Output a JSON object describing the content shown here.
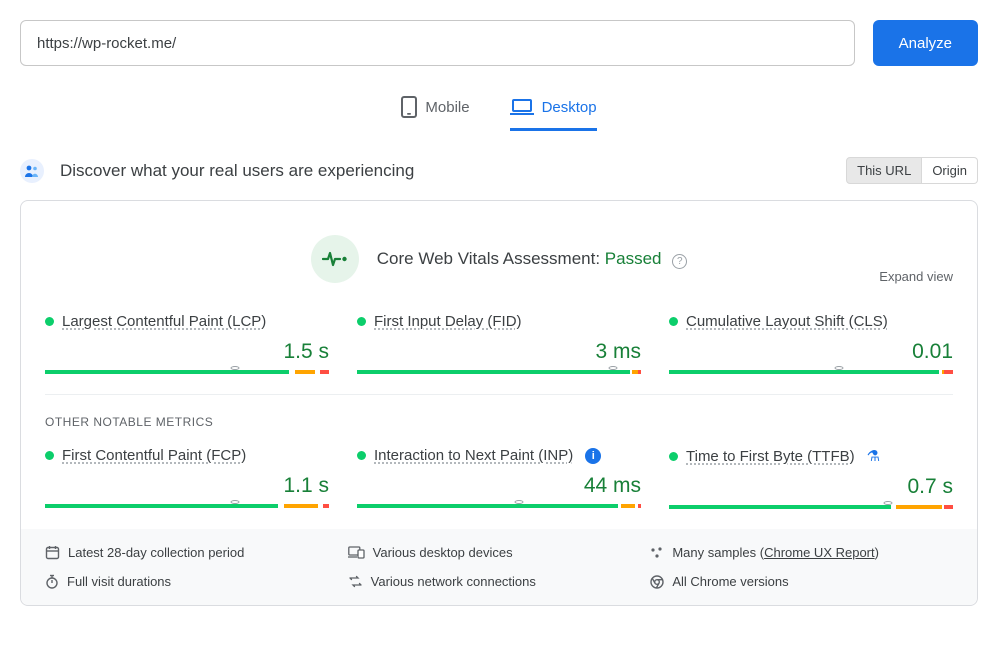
{
  "input": {
    "url_value": "https://wp-rocket.me/",
    "analyze_label": "Analyze"
  },
  "tabs": {
    "mobile": "Mobile",
    "desktop": "Desktop"
  },
  "discover": {
    "heading": "Discover what your real users are experiencing",
    "this_url": "This URL",
    "origin": "Origin"
  },
  "assessment": {
    "label_prefix": "Core Web Vitals Assessment: ",
    "status": "Passed",
    "expand": "Expand view"
  },
  "section": {
    "other": "OTHER NOTABLE METRICS"
  },
  "metrics": {
    "lcp": {
      "name": "Largest Contentful Paint (LCP)",
      "value": "1.5 s",
      "marker": 67,
      "segs": [
        86,
        2,
        7,
        2,
        3
      ]
    },
    "fid": {
      "name": "First Input Delay (FID)",
      "value": "3 ms",
      "marker": 90,
      "segs": [
        96,
        1,
        2,
        0,
        1
      ]
    },
    "cls": {
      "name": "Cumulative Layout Shift (CLS)",
      "value": "0.01",
      "marker": 60,
      "segs": [
        95,
        1,
        1,
        0,
        3
      ]
    },
    "fcp": {
      "name": "First Contentful Paint (FCP)",
      "value": "1.1 s",
      "marker": 67,
      "segs": [
        82,
        2,
        12,
        2,
        2
      ]
    },
    "inp": {
      "name": "Interaction to Next Paint (INP)",
      "value": "44 ms",
      "marker": 57,
      "segs": [
        92,
        1,
        5,
        1,
        1
      ]
    },
    "ttfb": {
      "name": "Time to First Byte (TTFB)",
      "value": "0.7 s",
      "marker": 77,
      "segs": [
        78,
        2,
        16,
        1,
        3
      ]
    }
  },
  "footer": {
    "period": "Latest 28-day collection period",
    "devices": "Various desktop devices",
    "samples_prefix": "Many samples (",
    "samples_link": "Chrome UX Report",
    "samples_suffix": ")",
    "durations": "Full visit durations",
    "network": "Various network connections",
    "browsers": "All Chrome versions"
  },
  "chart_data": [
    {
      "type": "bar",
      "title": "Largest Contentful Paint (LCP)",
      "value": "1.5 s",
      "distribution_pct": {
        "good": 89,
        "needs_improvement": 8,
        "poor": 3
      },
      "marker_pct": 67
    },
    {
      "type": "bar",
      "title": "First Input Delay (FID)",
      "value": "3 ms",
      "distribution_pct": {
        "good": 97,
        "needs_improvement": 2,
        "poor": 1
      },
      "marker_pct": 90
    },
    {
      "type": "bar",
      "title": "Cumulative Layout Shift (CLS)",
      "value": "0.01",
      "distribution_pct": {
        "good": 96,
        "needs_improvement": 1,
        "poor": 3
      },
      "marker_pct": 60
    },
    {
      "type": "bar",
      "title": "First Contentful Paint (FCP)",
      "value": "1.1 s",
      "distribution_pct": {
        "good": 84,
        "needs_improvement": 13,
        "poor": 3
      },
      "marker_pct": 67
    },
    {
      "type": "bar",
      "title": "Interaction to Next Paint (INP)",
      "value": "44 ms",
      "distribution_pct": {
        "good": 93,
        "needs_improvement": 6,
        "poor": 1
      },
      "marker_pct": 57
    },
    {
      "type": "bar",
      "title": "Time to First Byte (TTFB)",
      "value": "0.7 s",
      "distribution_pct": {
        "good": 79,
        "needs_improvement": 17,
        "poor": 4
      },
      "marker_pct": 77
    }
  ]
}
